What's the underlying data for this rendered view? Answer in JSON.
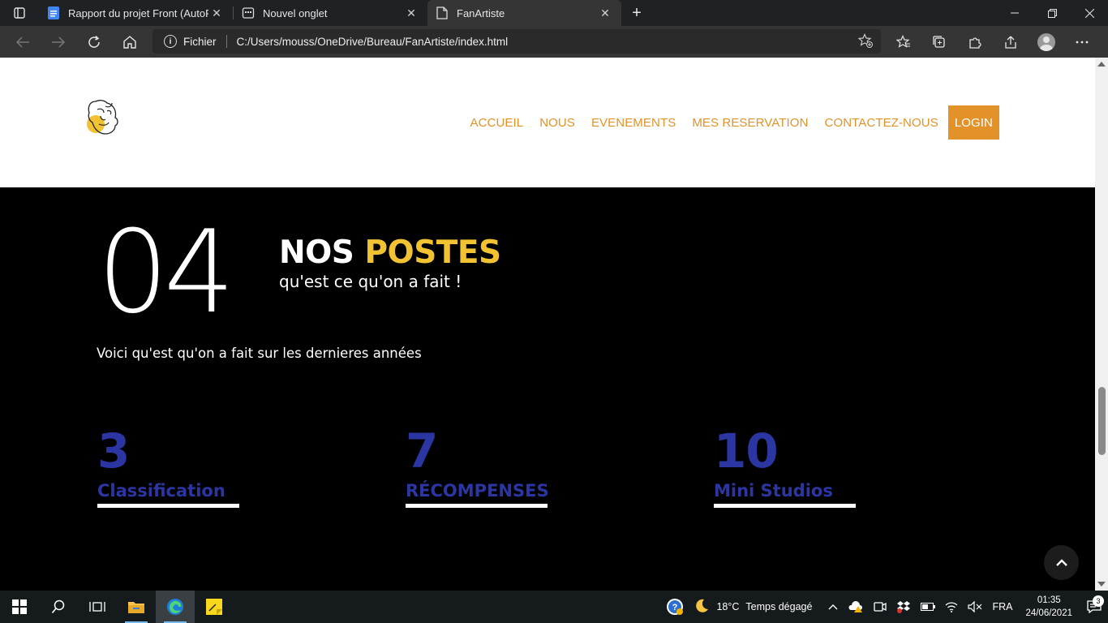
{
  "browser": {
    "tabs": [
      {
        "title": "Rapport du projet Front (AutoRe",
        "icon": "docs-icon",
        "active": false
      },
      {
        "title": "Nouvel onglet",
        "icon": "newtab-icon",
        "active": false
      },
      {
        "title": "FanArtiste",
        "icon": "page-icon",
        "active": true
      }
    ],
    "address": {
      "scheme_label": "Fichier",
      "url": "C:/Users/mouss/OneDrive/Bureau/FanArtiste/index.html"
    }
  },
  "site": {
    "nav": {
      "items": [
        "ACCUEIL",
        "NOUS",
        "EVENEMENTS",
        "MES RESERVATION",
        "CONTACTEZ-NOUS"
      ],
      "login": "LOGIN"
    },
    "section": {
      "number": "04",
      "title_main": "NOS",
      "title_highlight": "POSTES",
      "subtitle": "qu'est ce qu'on a fait !",
      "intro": "Voici qu'est qu'on a fait sur les dernieres années"
    },
    "stats": [
      {
        "value": "3",
        "label": "Classification"
      },
      {
        "value": "7",
        "label": "RÉCOMPENSES"
      },
      {
        "value": "10",
        "label": "Mini Studios"
      }
    ],
    "colors": {
      "accent": "#e39229",
      "highlight": "#f1c232",
      "stat": "#2b36a3"
    }
  },
  "taskbar": {
    "weather": {
      "temp": "18°C",
      "desc": "Temps dégagé"
    },
    "language": "FRA",
    "time": "01:35",
    "date": "24/06/2021",
    "notifications": "3"
  }
}
